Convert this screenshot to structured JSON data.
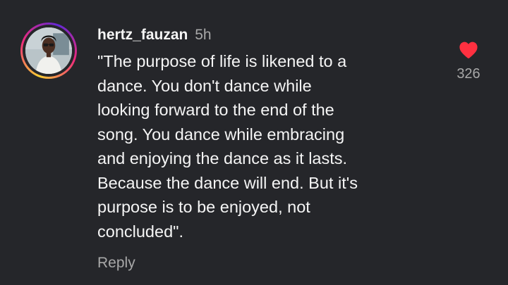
{
  "comment": {
    "username": "hertz_fauzan",
    "time": "5h",
    "text": "\"The purpose of life is likened to a\ndance. You don't dance while\nlooking forward to the end of the\nsong. You dance while embracing\nand enjoying the dance as it lasts.\nBecause the dance will end. But it's\npurpose is to be enjoyed, not\nconcluded\".",
    "reply_label": "Reply",
    "like_count": "326",
    "liked": true,
    "heart_icon": "heart-filled-icon"
  },
  "colors": {
    "background": "#25262a",
    "primary_text": "#f5f5f5",
    "secondary_text": "#a8a8a8",
    "heart": "#ff3040"
  }
}
